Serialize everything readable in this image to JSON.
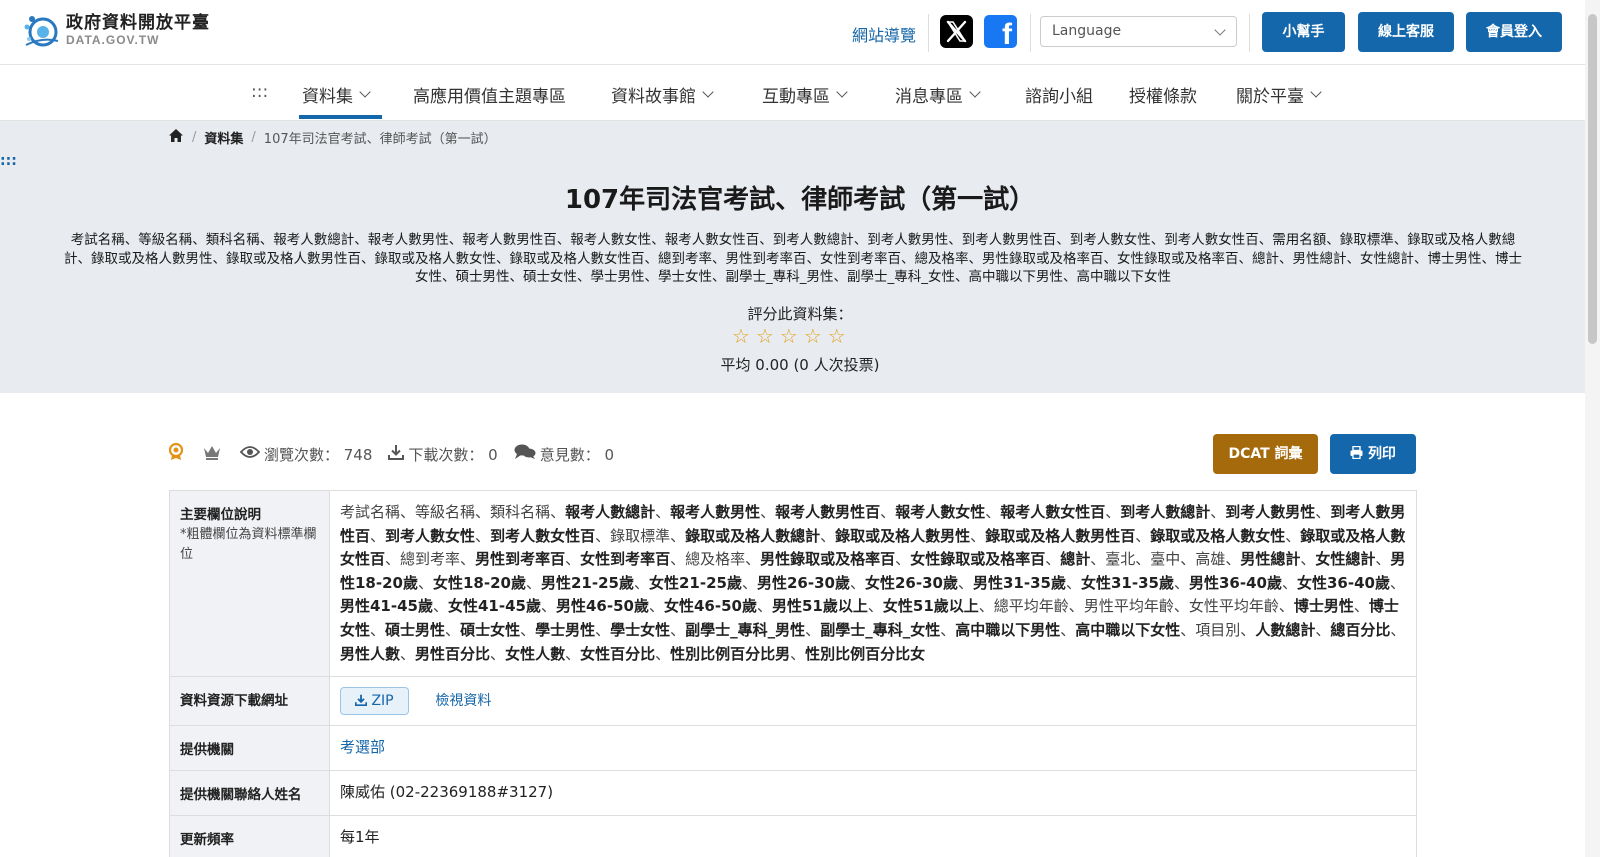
{
  "header": {
    "logo_title": "政府資料開放平臺",
    "logo_sub": "DATA.GOV.TW",
    "site_nav": "網站導覽",
    "language_placeholder": "Language",
    "buttons": [
      "小幫手",
      "線上客服",
      "會員登入"
    ]
  },
  "nav": {
    "dots": ":::",
    "items": [
      "資料集",
      "高應用價值主題專區",
      "資料故事館",
      "互動專區",
      "消息專區",
      "諮詢小組",
      "授權條款",
      "關於平臺"
    ]
  },
  "breadcrumb": {
    "dataset_link": "資料集",
    "current": "107年司法官考試、律師考試（第一試）"
  },
  "hero": {
    "side_dots": ":::",
    "title": "107年司法官考試、律師考試（第一試）",
    "description": "考試名稱、等級名稱、類科名稱、報考人數總計、報考人數男性、報考人數男性百、報考人數女性、報考人數女性百、到考人數總計、到考人數男性、到考人數男性百、到考人數女性、到考人數女性百、需用名額、錄取標準、錄取或及格人數總計、錄取或及格人數男性、錄取或及格人數男性百、錄取或及格人數女性、錄取或及格人數女性百、總到考率、男性到考率百、女性到考率百、總及格率、男性錄取或及格率百、女性錄取或及格率百、總計、男性總計、女性總計、博士男性、博士女性、碩士男性、碩士女性、學士男性、學士女性、副學士_專科_男性、副學士_專科_女性、高中職以下男性、高中職以下女性",
    "rate_label": "評分此資料集：",
    "rating_value": 0,
    "rating_max": 5,
    "average": "平均 0.00 (0 人次投票)"
  },
  "stats": {
    "views": "瀏覽次數： 748",
    "downloads": "下載次數： 0",
    "comments": "意見數： 0",
    "dcat_button": "DCAT 詞彙",
    "print_button": "列印"
  },
  "info": {
    "fields_key": "主要欄位說明",
    "fields_note": "*粗體欄位為資料標準欄位",
    "fields": [
      {
        "t": "考試名稱",
        "b": false
      },
      {
        "t": "等級名稱",
        "b": false
      },
      {
        "t": "類科名稱",
        "b": false
      },
      {
        "t": "報考人數總計",
        "b": true
      },
      {
        "t": "報考人數男性",
        "b": true
      },
      {
        "t": "報考人數男性百",
        "b": true
      },
      {
        "t": "報考人數女性",
        "b": true
      },
      {
        "t": "報考人數女性百",
        "b": true
      },
      {
        "t": "到考人數總計",
        "b": true
      },
      {
        "t": "到考人數男性",
        "b": true
      },
      {
        "t": "到考人數男性百",
        "b": true
      },
      {
        "t": "到考人數女性",
        "b": true
      },
      {
        "t": "到考人數女性百",
        "b": true
      },
      {
        "t": "錄取標準",
        "b": false
      },
      {
        "t": "錄取或及格人數總計",
        "b": true
      },
      {
        "t": "錄取或及格人數男性",
        "b": true
      },
      {
        "t": "錄取或及格人數男性百",
        "b": true
      },
      {
        "t": "錄取或及格人數女性",
        "b": true
      },
      {
        "t": "錄取或及格人數女性百",
        "b": true
      },
      {
        "t": "總到考率",
        "b": false
      },
      {
        "t": "男性到考率百",
        "b": true
      },
      {
        "t": "女性到考率百",
        "b": true
      },
      {
        "t": "總及格率",
        "b": false
      },
      {
        "t": "男性錄取或及格率百",
        "b": true
      },
      {
        "t": "女性錄取或及格率百",
        "b": true
      },
      {
        "t": "總計",
        "b": true
      },
      {
        "t": "臺北",
        "b": false
      },
      {
        "t": "臺中",
        "b": false
      },
      {
        "t": "高雄",
        "b": false
      },
      {
        "t": "男性總計",
        "b": true
      },
      {
        "t": "女性總計",
        "b": true
      },
      {
        "t": "男性18-20歲",
        "b": true
      },
      {
        "t": "女性18-20歲",
        "b": true
      },
      {
        "t": "男性21-25歲",
        "b": true
      },
      {
        "t": "女性21-25歲",
        "b": true
      },
      {
        "t": "男性26-30歲",
        "b": true
      },
      {
        "t": "女性26-30歲",
        "b": true
      },
      {
        "t": "男性31-35歲",
        "b": true
      },
      {
        "t": "女性31-35歲",
        "b": true
      },
      {
        "t": "男性36-40歲",
        "b": true
      },
      {
        "t": "女性36-40歲",
        "b": true
      },
      {
        "t": "男性41-45歲",
        "b": true
      },
      {
        "t": "女性41-45歲",
        "b": true
      },
      {
        "t": "男性46-50歲",
        "b": true
      },
      {
        "t": "女性46-50歲",
        "b": true
      },
      {
        "t": "男性51歲以上",
        "b": true
      },
      {
        "t": "女性51歲以上",
        "b": true
      },
      {
        "t": "總平均年齡",
        "b": false
      },
      {
        "t": "男性平均年齡",
        "b": false
      },
      {
        "t": "女性平均年齡",
        "b": false
      },
      {
        "t": "博士男性",
        "b": true
      },
      {
        "t": "博士女性",
        "b": true
      },
      {
        "t": "碩士男性",
        "b": true
      },
      {
        "t": "碩士女性",
        "b": true
      },
      {
        "t": "學士男性",
        "b": true
      },
      {
        "t": "學士女性",
        "b": true
      },
      {
        "t": "副學士_專科_男性",
        "b": true
      },
      {
        "t": "副學士_專科_女性",
        "b": true
      },
      {
        "t": "高中職以下男性",
        "b": true
      },
      {
        "t": "高中職以下女性",
        "b": true
      },
      {
        "t": "項目別",
        "b": false
      },
      {
        "t": "人數總計",
        "b": true
      },
      {
        "t": "總百分比",
        "b": true
      },
      {
        "t": "男性人數",
        "b": true
      },
      {
        "t": "男性百分比",
        "b": true
      },
      {
        "t": "女性人數",
        "b": true
      },
      {
        "t": "女性百分比",
        "b": true
      },
      {
        "t": "性別比例百分比男",
        "b": true
      },
      {
        "t": "性別比例百分比女",
        "b": true
      }
    ],
    "download_key": "資料資源下載網址",
    "zip_label": "ZIP",
    "view_label": "檢視資料",
    "agency_key": "提供機關",
    "agency": "考選部",
    "contact_key": "提供機關聯絡人姓名",
    "contact": "陳威佑 (02-22369188#3127)",
    "freq_key": "更新頻率",
    "freq": "每1年"
  },
  "colors": {
    "primary": "#1567ac",
    "dcat": "#a46a0b",
    "hero_bg": "#e8ecf1",
    "star": "#e2a21b"
  }
}
